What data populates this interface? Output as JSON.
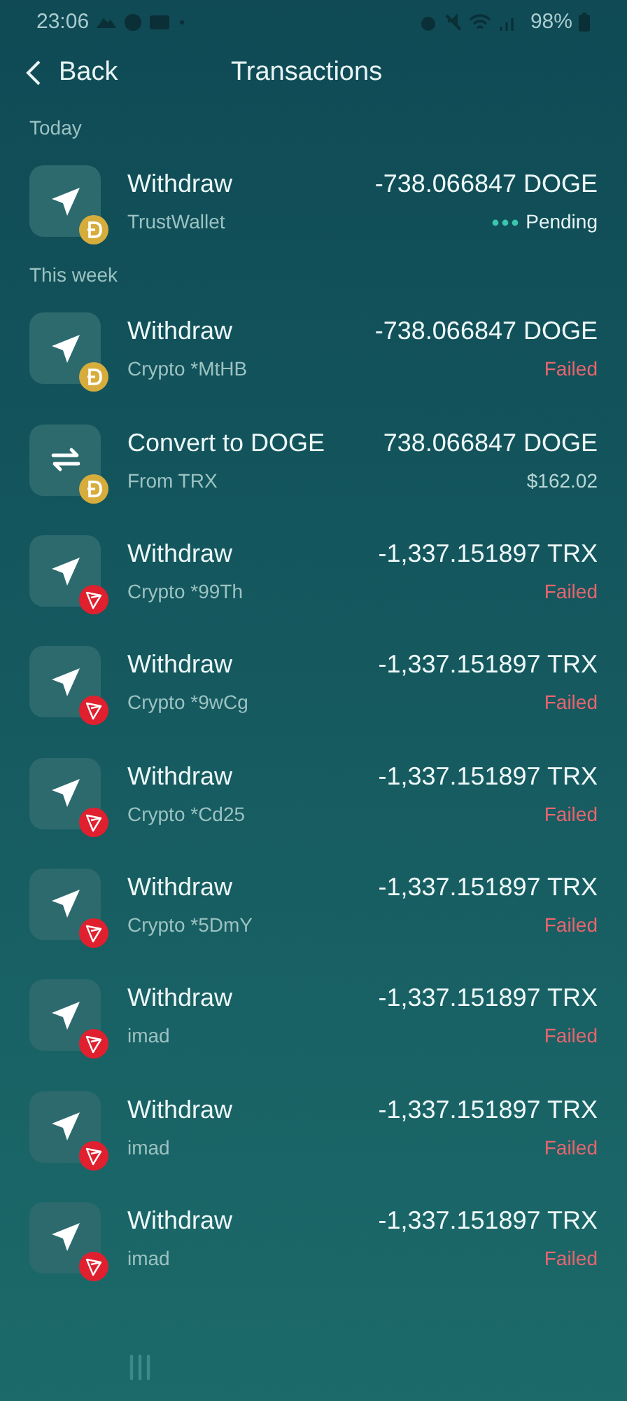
{
  "status_bar": {
    "time": "23:06",
    "battery": "98%"
  },
  "header": {
    "back": "Back",
    "title": "Transactions"
  },
  "sections": [
    {
      "title": "Today",
      "transactions": [
        {
          "kind": "withdraw",
          "badge": {
            "kind": "doge"
          },
          "title": "Withdraw",
          "subtitle": "TrustWallet",
          "amount": "-738.066847 DOGE",
          "status": {
            "kind": "pending",
            "text": "Pending"
          }
        }
      ]
    },
    {
      "title": "This week",
      "transactions": [
        {
          "kind": "withdraw",
          "badge": {
            "kind": "doge"
          },
          "title": "Withdraw",
          "subtitle": "Crypto *MtHB",
          "amount": "-738.066847 DOGE",
          "status": {
            "kind": "failed",
            "text": "Failed"
          }
        },
        {
          "kind": "convert",
          "badge": {
            "kind": "doge"
          },
          "title": "Convert to DOGE",
          "subtitle": "From TRX",
          "amount": "738.066847 DOGE",
          "status": {
            "kind": "value",
            "text": "$162.02"
          }
        },
        {
          "kind": "withdraw",
          "badge": {
            "kind": "trx"
          },
          "title": "Withdraw",
          "subtitle": "Crypto *99Th",
          "amount": "-1,337.151897 TRX",
          "status": {
            "kind": "failed",
            "text": "Failed"
          }
        },
        {
          "kind": "withdraw",
          "badge": {
            "kind": "trx"
          },
          "title": "Withdraw",
          "subtitle": "Crypto *9wCg",
          "amount": "-1,337.151897 TRX",
          "status": {
            "kind": "failed",
            "text": "Failed"
          }
        },
        {
          "kind": "withdraw",
          "badge": {
            "kind": "trx"
          },
          "title": "Withdraw",
          "subtitle": "Crypto *Cd25",
          "amount": "-1,337.151897 TRX",
          "status": {
            "kind": "failed",
            "text": "Failed"
          }
        },
        {
          "kind": "withdraw",
          "badge": {
            "kind": "trx"
          },
          "title": "Withdraw",
          "subtitle": "Crypto *5DmY",
          "amount": "-1,337.151897 TRX",
          "status": {
            "kind": "failed",
            "text": "Failed"
          }
        },
        {
          "kind": "withdraw",
          "badge": {
            "kind": "trx"
          },
          "title": "Withdraw",
          "subtitle": "imad",
          "amount": "-1,337.151897 TRX",
          "status": {
            "kind": "failed",
            "text": "Failed"
          }
        },
        {
          "kind": "withdraw",
          "badge": {
            "kind": "trx"
          },
          "title": "Withdraw",
          "subtitle": "imad",
          "amount": "-1,337.151897 TRX",
          "status": {
            "kind": "failed",
            "text": "Failed"
          }
        },
        {
          "kind": "withdraw",
          "badge": {
            "kind": "trx"
          },
          "title": "Withdraw",
          "subtitle": "imad",
          "amount": "-1,337.151897 TRX",
          "status": {
            "kind": "failed",
            "text": "Failed"
          }
        }
      ]
    }
  ]
}
